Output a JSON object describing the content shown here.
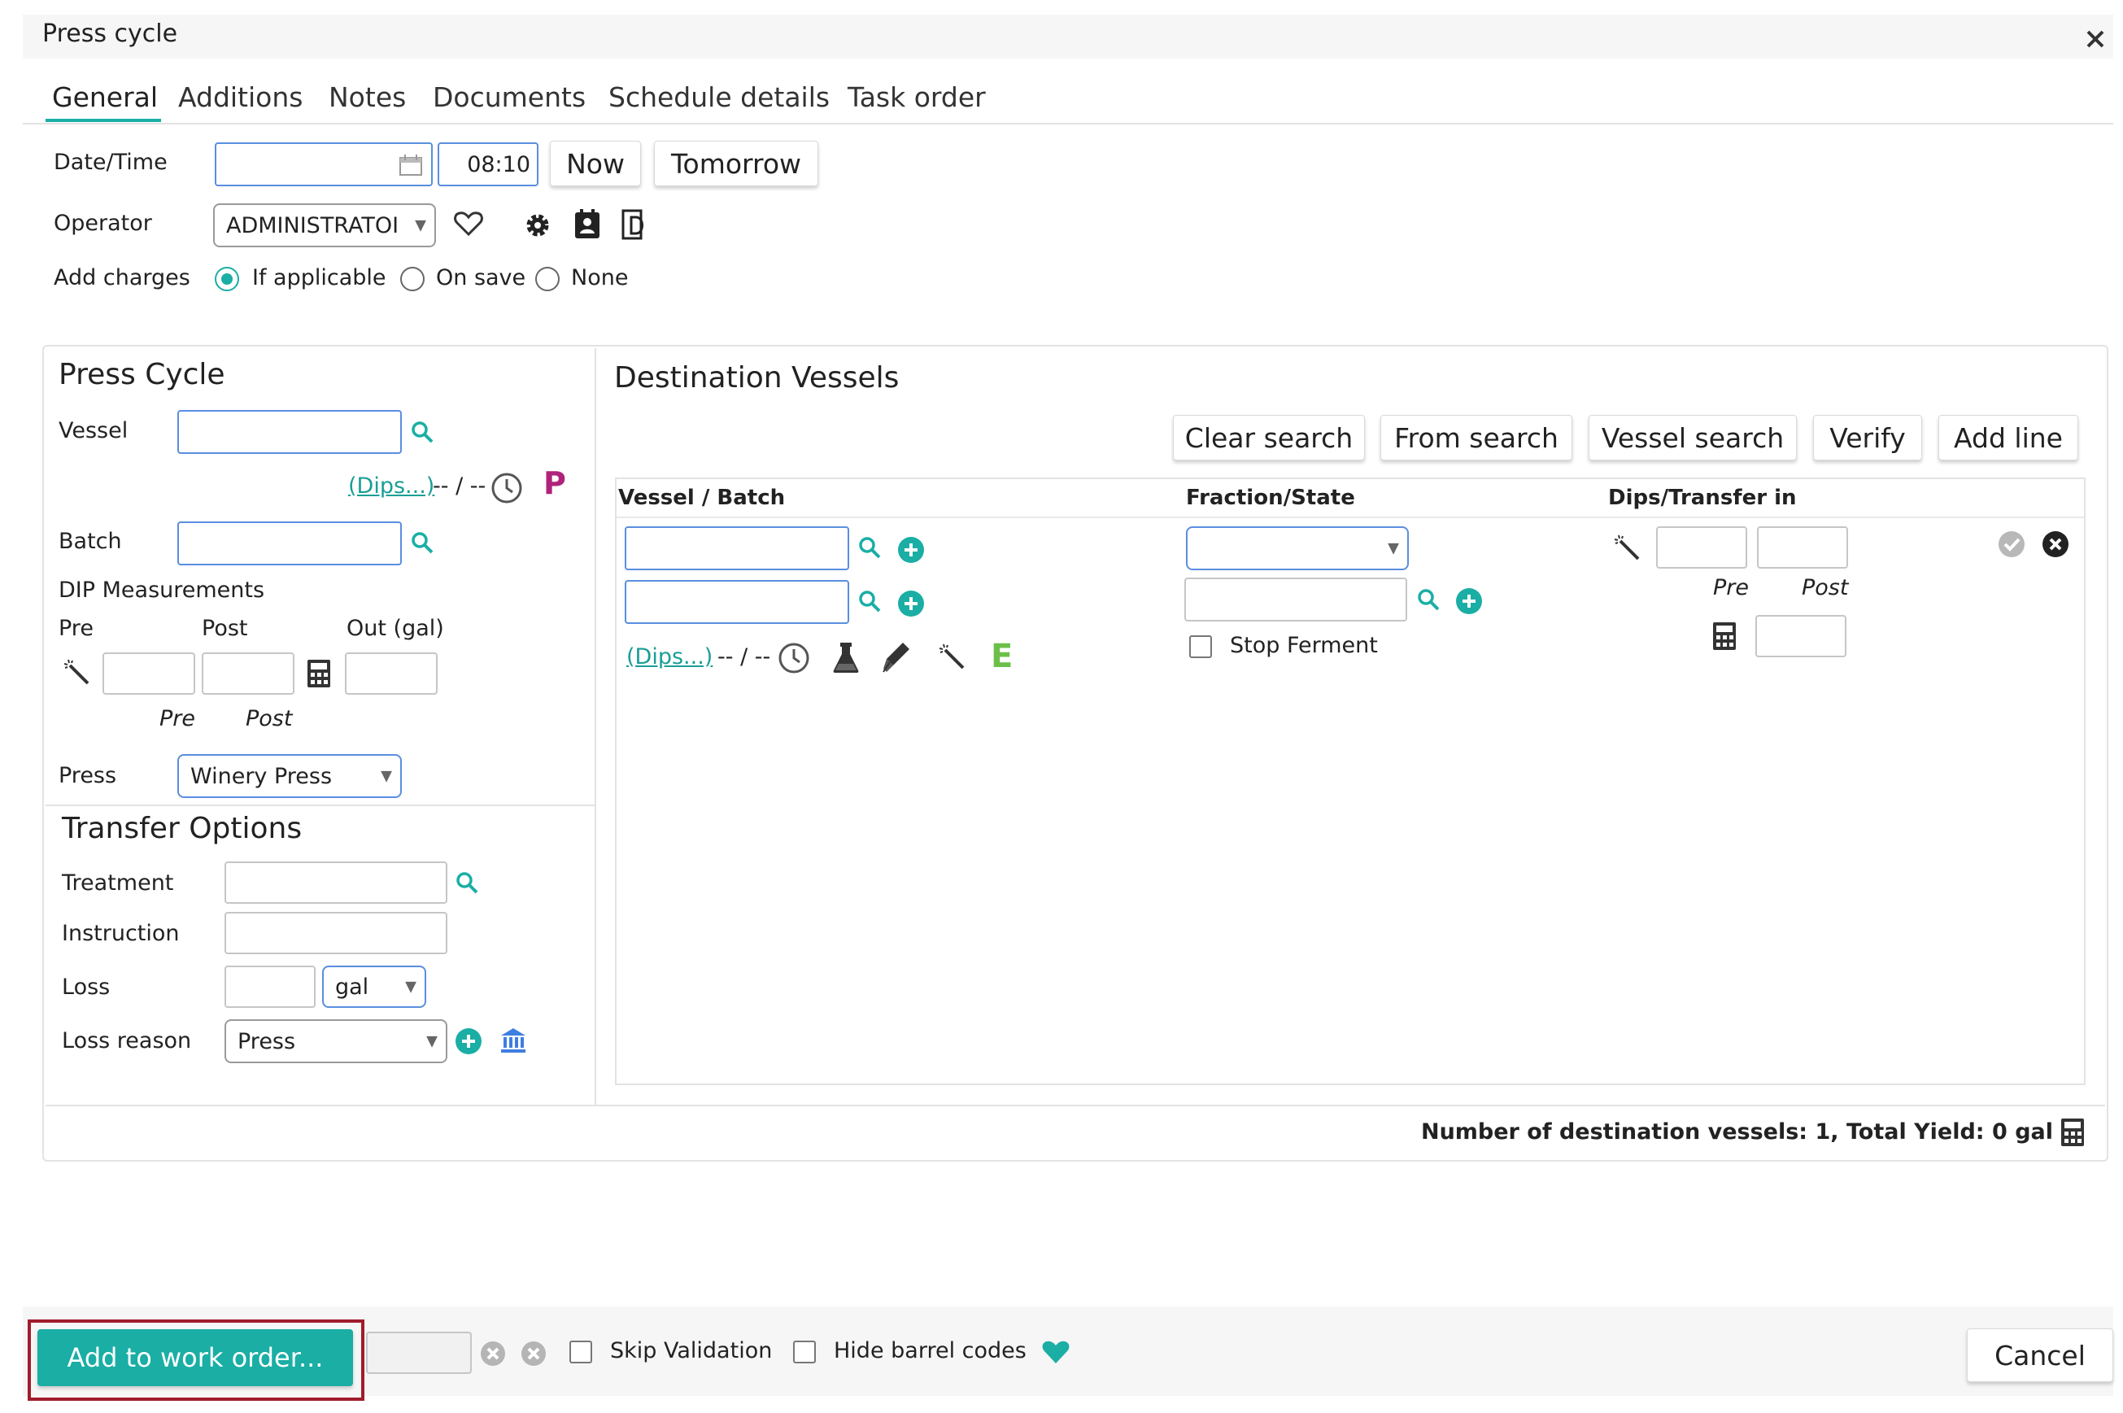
{
  "window": {
    "title": "Press cycle"
  },
  "tabs": [
    "General",
    "Additions",
    "Notes",
    "Documents",
    "Schedule details",
    "Task order"
  ],
  "general": {
    "datetime_label": "Date/Time",
    "date_value": "",
    "time_value": "08:10",
    "now_label": "Now",
    "tomorrow_label": "Tomorrow",
    "operator_label": "Operator",
    "operator_value": "ADMINISTRATOI",
    "add_charges_label": "Add charges",
    "charges_options": [
      "If applicable",
      "On save",
      "None"
    ],
    "charges_selected": "If applicable"
  },
  "press_cycle": {
    "title": "Press Cycle",
    "vessel_label": "Vessel",
    "vessel_value": "",
    "dips_link": "(Dips...)",
    "dips_value": "-- / --",
    "p_badge": "P",
    "batch_label": "Batch",
    "batch_value": "",
    "dip_title": "DIP Measurements",
    "pre_label": "Pre",
    "post_label": "Post",
    "out_label": "Out (gal)",
    "pre_caption": "Pre",
    "post_caption": "Post",
    "press_label": "Press",
    "press_value": "Winery Press"
  },
  "transfer_options": {
    "title": "Transfer Options",
    "treatment_label": "Treatment",
    "instruction_label": "Instruction",
    "loss_label": "Loss",
    "loss_unit": "gal",
    "loss_reason_label": "Loss reason",
    "loss_reason_value": "Press"
  },
  "destination": {
    "title": "Destination Vessels",
    "buttons": [
      "Clear search",
      "From search",
      "Vessel search",
      "Verify",
      "Add line"
    ],
    "columns": [
      "Vessel / Batch",
      "Fraction/State",
      "Dips/Transfer in"
    ],
    "row": {
      "dips_link": "(Dips...)",
      "dips_value": "-- / --",
      "e_badge": "E",
      "stop_ferment_label": "Stop Ferment",
      "pre_caption": "Pre",
      "post_caption": "Post"
    },
    "summary": "Number of destination vessels: 1, Total Yield: 0 gal"
  },
  "footer": {
    "add_work_order_label": "Add to work order...",
    "skip_validation_label": "Skip Validation",
    "hide_barrel_codes_label": "Hide barrel codes",
    "cancel_label": "Cancel"
  },
  "colors": {
    "accent": "#1aaea5",
    "highlight_border": "#a01c2c",
    "p_badge": "#b0237a",
    "e_badge": "#6cc04a"
  },
  "icons": [
    "calendar-icon",
    "heart-outline-icon",
    "gear-icon",
    "contact-card-icon",
    "document-d-icon",
    "search-icon",
    "clock-icon",
    "wand-icon",
    "calculator-icon",
    "add-circle-icon",
    "bank-icon",
    "flask-icon",
    "pipette-icon",
    "check-circle-icon",
    "close-circle-icon",
    "heart-filled-icon",
    "close-icon"
  ]
}
